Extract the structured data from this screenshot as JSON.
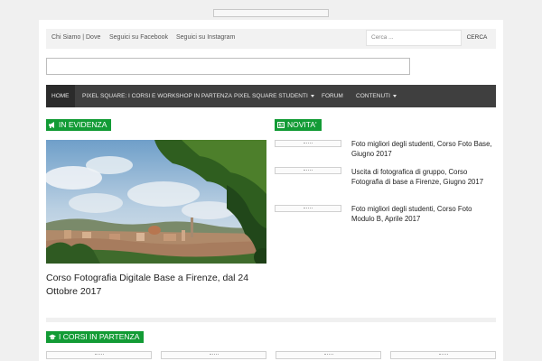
{
  "top_links": [
    "Chi Siamo | Dove",
    "Seguici su Facebook",
    "Seguici su Instagram"
  ],
  "search": {
    "placeholder": "Cerca ...",
    "button": "CERCA"
  },
  "nav": {
    "items": [
      {
        "label": "HOME",
        "active": true,
        "dropdown": false
      },
      {
        "label": "PIXEL SQUARE: I CORSI E WORKSHOP IN PARTENZA",
        "active": false,
        "dropdown": false
      },
      {
        "label": "PIXEL SQUARE STUDENTI",
        "active": false,
        "dropdown": true
      },
      {
        "label": "FORUM",
        "active": false,
        "dropdown": false
      },
      {
        "label": "CONTENUTI",
        "active": false,
        "dropdown": true
      }
    ]
  },
  "sections": {
    "featured_title": "IN EVIDENZA",
    "news_title": "NOVITA'",
    "courses_title": "I CORSI IN PARTENZA"
  },
  "featured": {
    "headline": "Corso Fotografia Digitale Base a Firenze, dal 24 Ottobre 2017"
  },
  "news": [
    "Foto migliori degli studenti, Corso Foto Base, Giugno 2017",
    "Uscita di fotografica di gruppo, Corso Fotografia di base a Firenze, Giugno 2017",
    "Foto migliori degli studenti, Corso Foto Modulo B, Aprile 2017"
  ],
  "colors": {
    "accent_green": "#129b35",
    "nav_bg": "#3f3f3f",
    "page_bg": "#f0f0f0"
  },
  "icons": {
    "featured": "megaphone-icon",
    "news": "newspaper-icon",
    "courses": "graduation-cap-icon",
    "dropdown": "caret-down-icon"
  }
}
